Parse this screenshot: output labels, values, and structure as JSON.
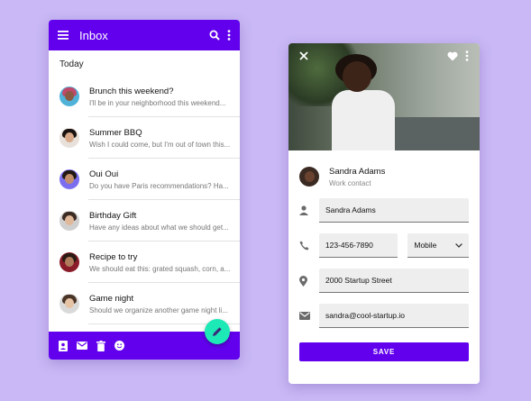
{
  "inbox": {
    "title": "Inbox",
    "section": "Today",
    "items": [
      {
        "title": "Brunch this weekend?",
        "preview": "I'll be in your neighborhood this weekend..."
      },
      {
        "title": "Summer BBQ",
        "preview": "Wish I could come, but I'm out of town this..."
      },
      {
        "title": "Oui Oui",
        "preview": "Do you have Paris recommendations? Ha..."
      },
      {
        "title": "Birthday Gift",
        "preview": "Have any ideas about what we should get..."
      },
      {
        "title": "Recipe to try",
        "preview": "We should eat this: grated squash, corn, a..."
      },
      {
        "title": "Game night",
        "preview": "Should we organize another game night li..."
      }
    ]
  },
  "contact": {
    "name": "Sandra Adams",
    "role": "Work contact",
    "fields": {
      "name": "Sandra Adams",
      "phone": "123-456-7890",
      "phone_type": "Mobile",
      "address": "2000 Startup Street",
      "email": "sandra@cool-startup.io"
    },
    "save_label": "SAVE"
  },
  "colors": {
    "primary": "#6200ee",
    "accent": "#1de9b6",
    "background": "#c9b8f5"
  },
  "icons": {
    "appbar": [
      "menu-icon",
      "search-icon",
      "more-vert-icon"
    ],
    "bottombar": [
      "contacts-icon",
      "mail-icon",
      "trash-icon",
      "emoji-icon"
    ],
    "fab": "edit-icon",
    "hero": [
      "close-icon",
      "heart-icon",
      "more-vert-icon"
    ],
    "form": [
      "person-icon",
      "phone-icon",
      "location-icon",
      "email-icon",
      "chevron-down-icon"
    ]
  }
}
